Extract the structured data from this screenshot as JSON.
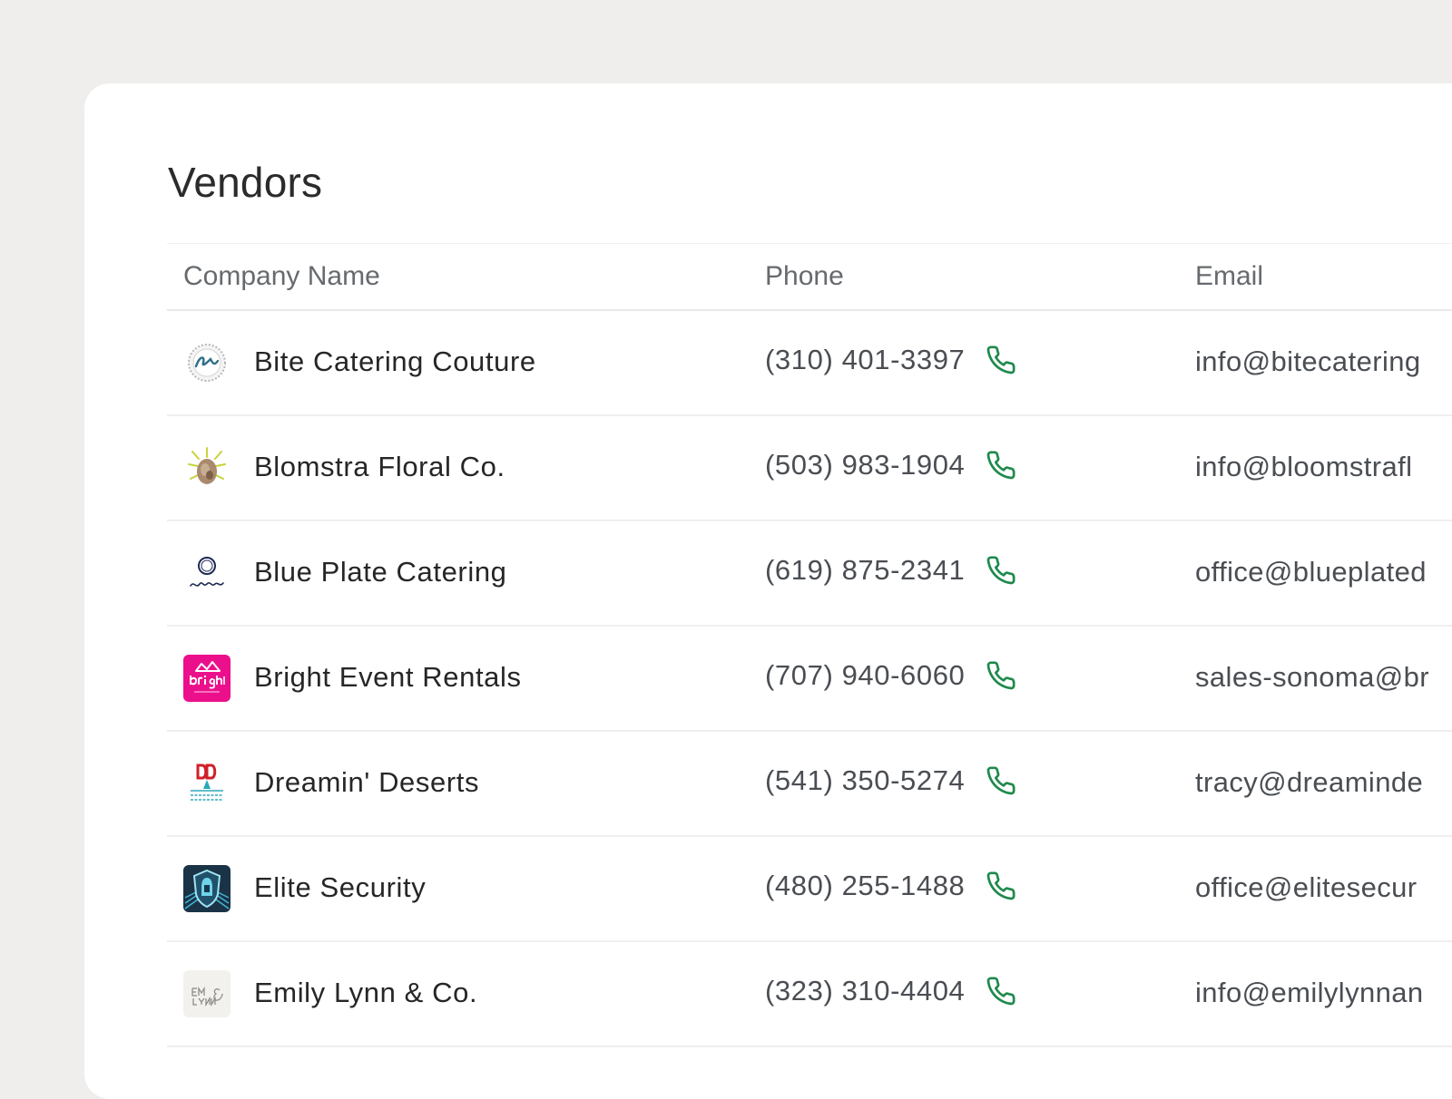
{
  "page": {
    "title": "Vendors"
  },
  "table": {
    "headers": {
      "company": "Company Name",
      "phone": "Phone",
      "email": "Email"
    },
    "rows": [
      {
        "company": "Bite Catering Couture",
        "phone": "(310) 401-3397",
        "email": "info@bitecatering",
        "logo": "bite-catering-logo"
      },
      {
        "company": "Blomstra Floral Co.",
        "phone": "(503) 983-1904",
        "email": "info@bloomstrafl",
        "logo": "blomstra-floral-logo"
      },
      {
        "company": "Blue Plate Catering",
        "phone": "(619) 875-2341",
        "email": "office@blueplated",
        "logo": "blue-plate-logo"
      },
      {
        "company": "Bright Event Rentals",
        "phone": "(707) 940-6060",
        "email": "sales-sonoma@br",
        "logo": "bright-event-logo"
      },
      {
        "company": "Dreamin' Deserts",
        "phone": "(541) 350-5274",
        "email": "tracy@dreaminde",
        "logo": "dreamin-deserts-logo"
      },
      {
        "company": "Elite Security",
        "phone": "(480) 255-1488",
        "email": "office@elitesecur",
        "logo": "elite-security-logo"
      },
      {
        "company": "Emily Lynn & Co.",
        "phone": "(323) 310-4404",
        "email": "info@emilylynnan",
        "logo": "emily-lynn-logo"
      }
    ]
  },
  "colors": {
    "background": "#efeeec",
    "card": "#ffffff",
    "phone_icon": "#1e8a4c",
    "bright_pink": "#ec0f8b"
  },
  "icons": {
    "phone": "phone-icon"
  }
}
